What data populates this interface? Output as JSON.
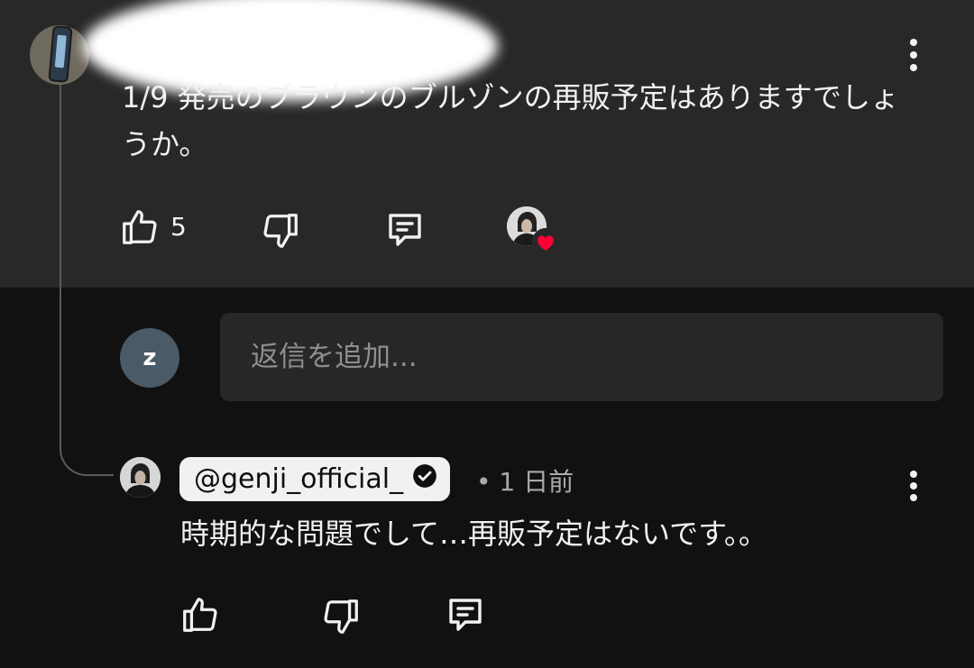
{
  "comment": {
    "author_redacted": "@",
    "text_line1": "1/9 発売のブラウンのブルゾンの再販予定はありますでしょうか。",
    "like_count": "5",
    "icons": {
      "like": "thumbs-up-icon",
      "dislike": "thumbs-down-icon",
      "reply": "comment-icon",
      "creator_heart": "heart-icon",
      "menu": "more-vert-icon"
    }
  },
  "reply_input": {
    "avatar_letter": "z",
    "placeholder": "返信を追加..."
  },
  "reply": {
    "author": "@genji_official_",
    "time": "• 1 日前",
    "text": "時期的な問題でして…再販予定はないです。。",
    "icons": {
      "verified": "verified-check-icon",
      "like": "thumbs-up-icon",
      "dislike": "thumbs-down-icon",
      "reply": "comment-icon",
      "menu": "more-vert-icon"
    }
  },
  "colors": {
    "top_background": "#282828",
    "page_background": "#111111",
    "heart": "#ff0033"
  }
}
